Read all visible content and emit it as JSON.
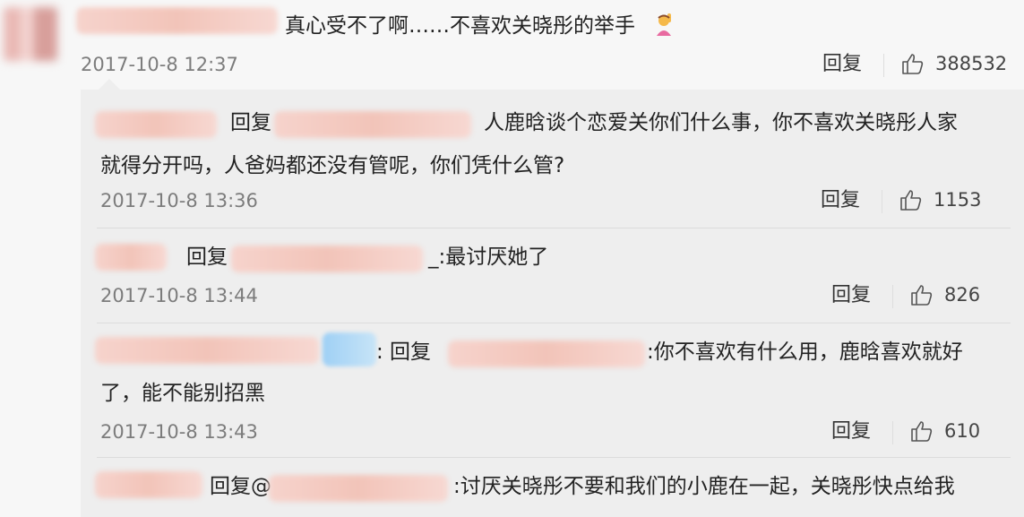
{
  "main_comment": {
    "text": "真心受不了啊……不喜欢关晓彤的举手",
    "timestamp": "2017-10-8 12:37",
    "reply_label": "回复",
    "likes": "388532"
  },
  "replies": [
    {
      "reply_prefix": "回复",
      "line1": "人鹿晗谈个恋爱关你们什么事，你不喜欢关晓彤人家",
      "line2": "就得分开吗，人爸妈都还没有管呢，你们凭什么管?",
      "timestamp": "2017-10-8 13:36",
      "reply_label": "回复",
      "likes": "1153"
    },
    {
      "reply_prefix": "回复",
      "line1": "_:最讨厌她了",
      "timestamp": "2017-10-8 13:44",
      "reply_label": "回复",
      "likes": "826"
    },
    {
      "reply_prefix": ": 回复",
      "line1": ":你不喜欢有什么用，鹿晗喜欢就好",
      "line2": "了，能不能别招黑",
      "timestamp": "2017-10-8 13:43",
      "reply_label": "回复",
      "likes": "610"
    },
    {
      "reply_prefix": "回复@",
      "line1": ":讨厌关晓彤不要和我们的小鹿在一起，关晓彤快点给我"
    }
  ],
  "icons": {
    "like": "thumbs-up-icon",
    "raised_hand": "raising-hand-emoji"
  },
  "colors": {
    "background": "#f7f7f7",
    "reply_panel": "#eeeeee",
    "meta_text": "#7c7c7c"
  }
}
